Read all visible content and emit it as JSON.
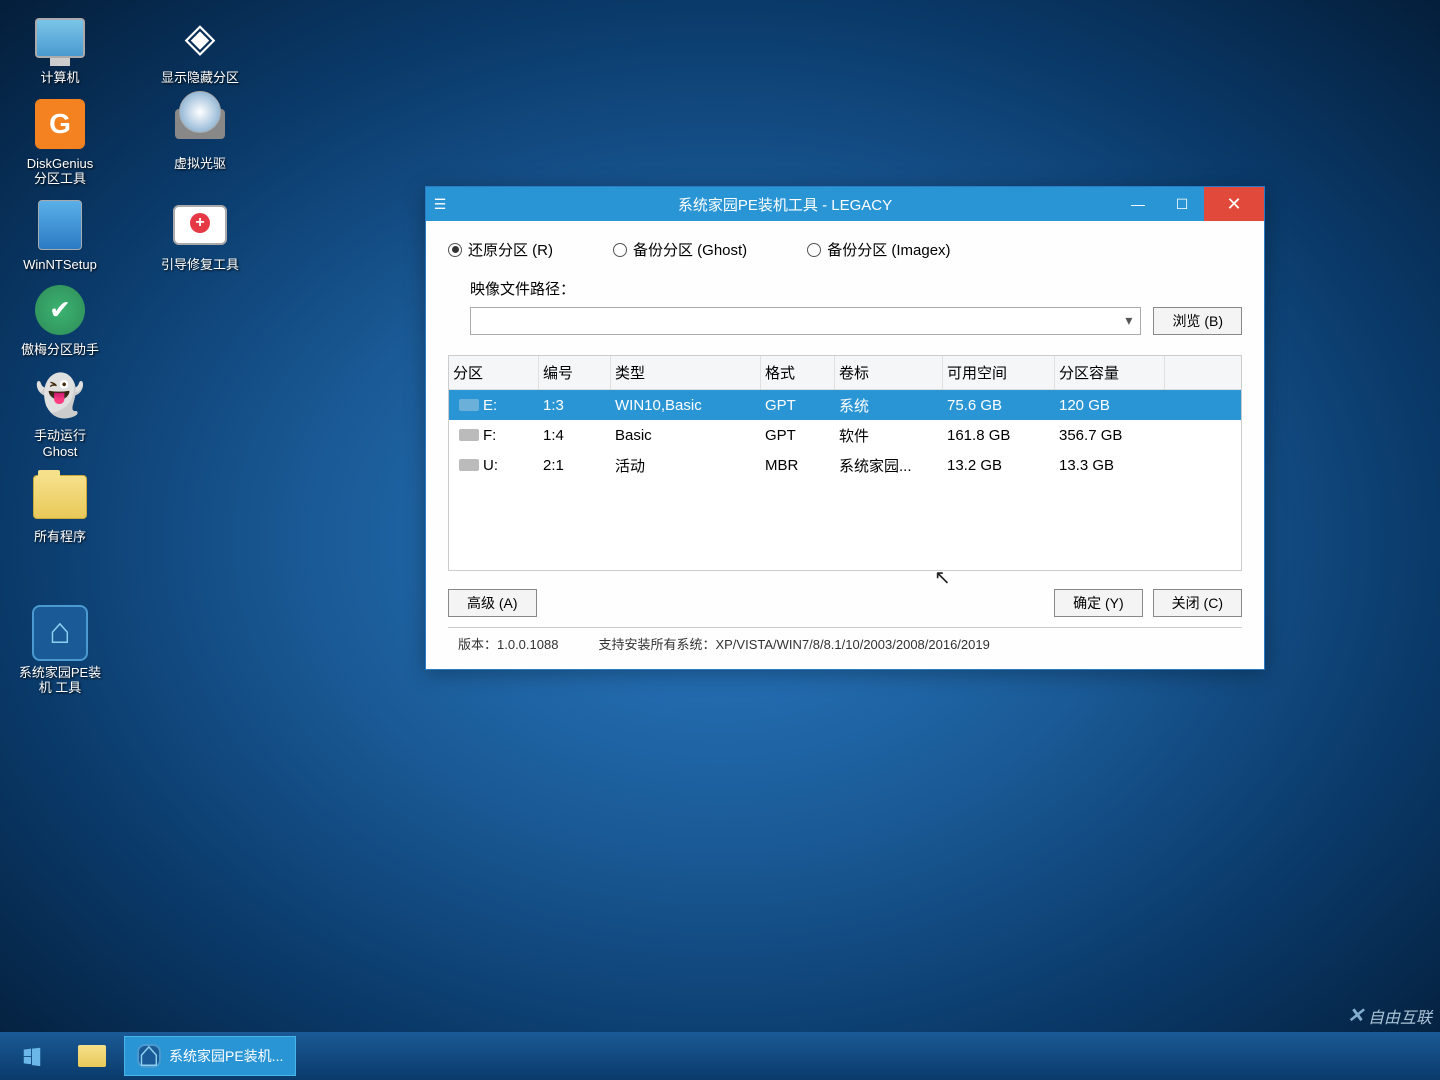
{
  "desktop": {
    "icons": [
      {
        "label": "计算机",
        "pair": "显示隐藏分区"
      },
      {
        "label": "DiskGenius\n分区工具",
        "pair": "虚拟光驱"
      },
      {
        "label": "WinNTSetup",
        "pair": "引导修复工具"
      },
      {
        "label": "傲梅分区助手",
        "pair": ""
      },
      {
        "label": "手动运行\nGhost",
        "pair": ""
      },
      {
        "label": "所有程序",
        "pair": ""
      },
      {
        "label": "系统家园PE装\n机 工具",
        "pair": ""
      }
    ]
  },
  "window": {
    "title": "系统家园PE装机工具 - LEGACY",
    "radios": {
      "restore": "还原分区 (R)",
      "backup_ghost": "备份分区 (Ghost)",
      "backup_imagex": "备份分区 (Imagex)"
    },
    "path_label": "映像文件路径：",
    "browse_btn": "浏览 (B)",
    "table": {
      "headers": {
        "partition": "分区",
        "number": "编号",
        "type": "类型",
        "format": "格式",
        "label": "卷标",
        "free": "可用空间",
        "size": "分区容量"
      },
      "rows": [
        {
          "part": "E:",
          "num": "1:3",
          "type": "WIN10,Basic",
          "fmt": "GPT",
          "lbl": "系统",
          "free": "75.6 GB",
          "size": "120 GB",
          "selected": true
        },
        {
          "part": "F:",
          "num": "1:4",
          "type": "Basic",
          "fmt": "GPT",
          "lbl": "软件",
          "free": "161.8 GB",
          "size": "356.7 GB",
          "selected": false
        },
        {
          "part": "U:",
          "num": "2:1",
          "type": "活动",
          "fmt": "MBR",
          "lbl": "系统家园...",
          "free": "13.2 GB",
          "size": "13.3 GB",
          "selected": false
        }
      ]
    },
    "buttons": {
      "advanced": "高级 (A)",
      "ok": "确定 (Y)",
      "close": "关闭 (C)"
    },
    "status": {
      "version": "版本：1.0.0.1088",
      "support": "支持安装所有系统：XP/VISTA/WIN7/8/8.1/10/2003/2008/2016/2019"
    }
  },
  "taskbar": {
    "app_label": "系统家园PE装机..."
  },
  "watermark": "自由互联"
}
